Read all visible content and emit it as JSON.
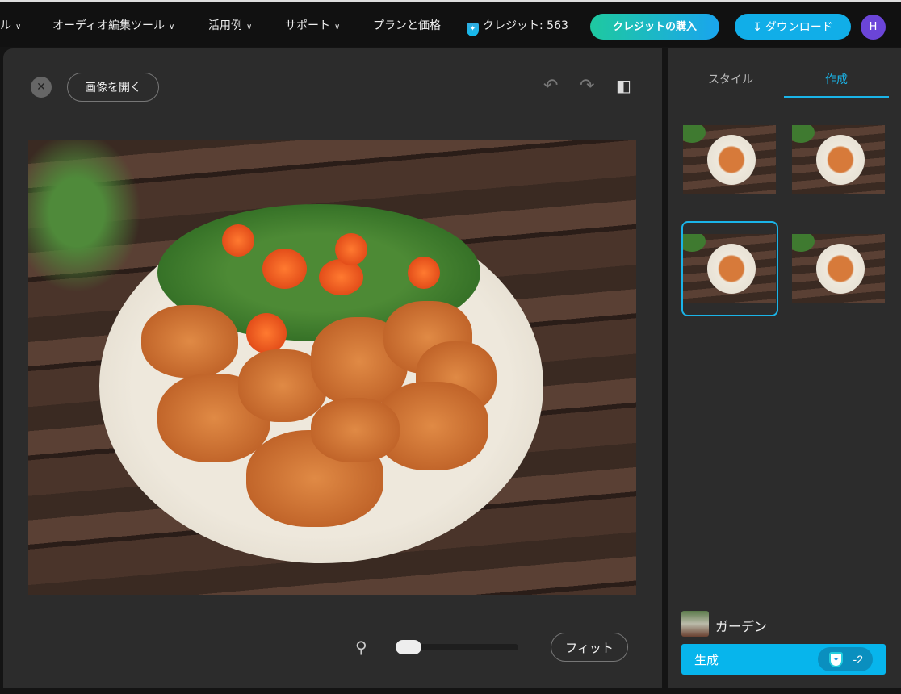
{
  "nav": {
    "items": [
      {
        "label": "ル"
      },
      {
        "label": "オーディオ編集ツール"
      },
      {
        "label": "活用例"
      },
      {
        "label": "サポート"
      }
    ],
    "plans": "プランと価格",
    "credits": "クレジット: 563",
    "buy": "クレジットの購入",
    "download": "ダウンロード",
    "avatar": "H"
  },
  "editor": {
    "open": "画像を開く",
    "fit": "フィット",
    "zoom_level": 0
  },
  "panel": {
    "tabs": [
      {
        "label": "スタイル"
      },
      {
        "label": "作成"
      }
    ],
    "active_tab": "作成",
    "selected_result": 3,
    "style_name": "ガーデン",
    "generate": "生成",
    "cost": "-2"
  },
  "colors": {
    "accent": "#07b5ec",
    "avatar": "#6b45d8"
  }
}
